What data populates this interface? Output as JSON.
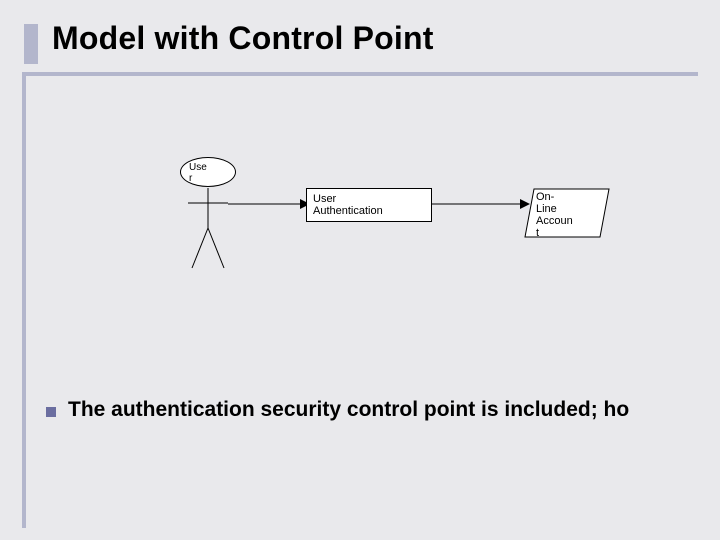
{
  "slide": {
    "title": "Model with Control Point",
    "bullet": "The authentication security control point is included; ho"
  },
  "diagram": {
    "actor_label": "User",
    "process_label": "User Authentication",
    "data_label": "On-Line Account"
  },
  "chart_data": {
    "type": "diagram",
    "title": "Model with Control Point",
    "nodes": [
      {
        "id": "user",
        "type": "actor",
        "label": "User"
      },
      {
        "id": "auth",
        "type": "process",
        "label": "User Authentication"
      },
      {
        "id": "account",
        "type": "data",
        "label": "On-Line Account"
      }
    ],
    "edges": [
      {
        "from": "user",
        "to": "auth",
        "directed": true
      },
      {
        "from": "auth",
        "to": "account",
        "directed": true
      }
    ],
    "annotations": [
      "The authentication security control point is included; ho"
    ]
  }
}
